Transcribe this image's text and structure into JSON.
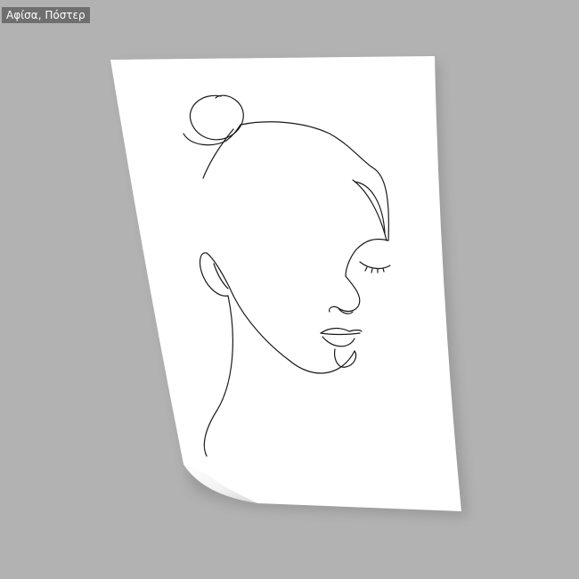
{
  "badge": {
    "label": "Αφίσα, Πόστερ"
  },
  "colors": {
    "background": "#b2b2b2",
    "paper": "#ffffff",
    "line_art": "#1a1a1a",
    "badge_background": "#6f6f6f",
    "badge_text": "#ffffff"
  },
  "artwork": {
    "style": "single continuous line drawing",
    "icon": "woman-face-line-art"
  }
}
